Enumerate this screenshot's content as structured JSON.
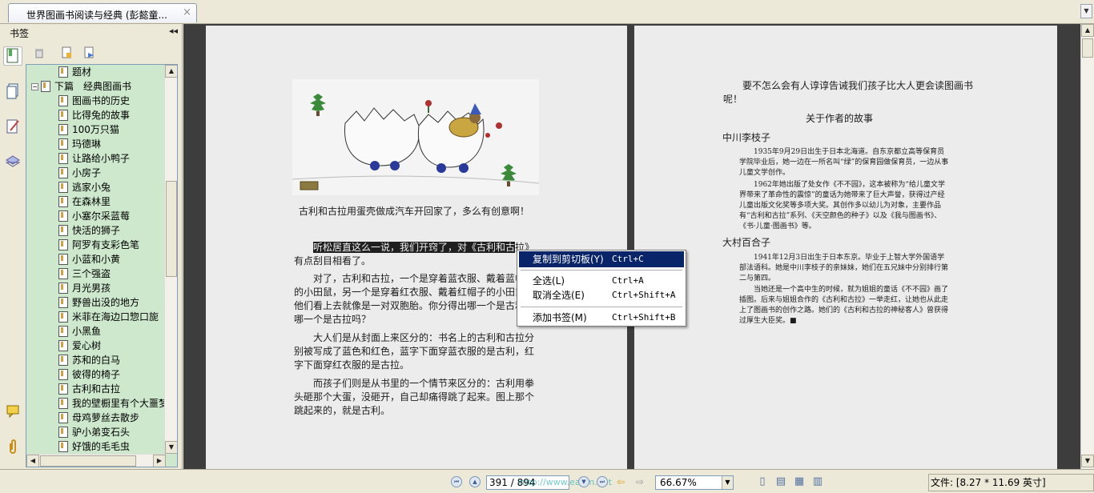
{
  "tab": {
    "title": "世界图画书阅读与经典 (彭懿童...",
    "close": "×",
    "menu": "▼"
  },
  "sidebar": {
    "title": "书签",
    "collapse": "◂◂",
    "bookmarks": [
      {
        "label": "题材",
        "level": 2
      },
      {
        "label": "下篇　经典图画书",
        "level": 1,
        "expanded": true,
        "toggle": "−"
      },
      {
        "label": "图画书的历史",
        "level": 2
      },
      {
        "label": "比得兔的故事",
        "level": 2
      },
      {
        "label": "100万只猫",
        "level": 2
      },
      {
        "label": "玛德琳",
        "level": 2
      },
      {
        "label": "让路给小鸭子",
        "level": 2
      },
      {
        "label": "小房子",
        "level": 2
      },
      {
        "label": "逃家小兔",
        "level": 2
      },
      {
        "label": "在森林里",
        "level": 2
      },
      {
        "label": "小塞尔采蓝莓",
        "level": 2
      },
      {
        "label": "快活的狮子",
        "level": 2
      },
      {
        "label": "阿罗有支彩色笔",
        "level": 2
      },
      {
        "label": "小蓝和小黄",
        "level": 2
      },
      {
        "label": "三个强盗",
        "level": 2
      },
      {
        "label": "月光男孩",
        "level": 2
      },
      {
        "label": "野兽出没的地方",
        "level": 2
      },
      {
        "label": "米菲在海边口惣口旎",
        "level": 2
      },
      {
        "label": "小黑鱼",
        "level": 2
      },
      {
        "label": "爱心树",
        "level": 2
      },
      {
        "label": "苏和的白马",
        "level": 2
      },
      {
        "label": "彼得的椅子",
        "level": 2
      },
      {
        "label": "古利和古拉",
        "level": 2
      },
      {
        "label": "我的壁橱里有个大噩梦",
        "level": 2
      },
      {
        "label": "母鸡萝丝去散步",
        "level": 2
      },
      {
        "label": "驴小弟变石头",
        "level": 2
      },
      {
        "label": "好饿的毛毛虫",
        "level": 2
      }
    ]
  },
  "left_page": {
    "caption": "古利和古拉用蛋壳做成汽车开回家了，多么有创意啊！",
    "p1_highlight": "听松居直这么一说，我们开窍了，对《古利和古",
    "p1_rest": "拉》有点刮目相看了。",
    "p2": "对了，古利和古拉，一个是穿着蓝衣服、戴着蓝帽子的小田鼠，另一个是穿着红衣服、戴着红帽子的小田鼠，他们看上去就像是一对双胞胎。你分得出哪一个是古利、哪一个是古拉吗？",
    "p3": "大人们是从封面上来区分的：书名上的古利和古拉分别被写成了蓝色和红色，蓝字下面穿蓝衣服的是古利，红字下面穿红衣服的是古拉。",
    "p4": "而孩子们则是从书里的一个情节来区分的：古利用拳头砸那个大蛋，没砸开，自己却痛得跳了起来。图上那个跳起来的，就是古利。"
  },
  "right_page": {
    "intro": "要不怎么会有人谆谆告诫我们孩子比大人更会读图画书呢！",
    "heading": "关于作者的故事",
    "author1": "中川李枝子",
    "a1p1": "1935年9月29日出生于日本北海道。自东京都立高等保育员学院毕业后，她一边在一所名叫“绿”的保育园做保育员，一边从事儿童文学创作。",
    "a1p2": "1962年她出版了处女作《不不园》，这本被称为“给儿童文学界带来了革命性的震惊”的童话为她带来了巨大声誉，获得过产经儿童出版文化奖等多项大奖。其创作多以幼儿为对象，主要作品有“古利和古拉”系列、《天空颜色的种子》以及《我与图画书》、《书·儿童·图画书》等。",
    "author2": "大村百合子",
    "a2p1": "1941年12月3日出生于日本东京。毕业于上智大学外国语学部法语科。她是中川李枝子的亲妹妹，她们在五兄妹中分别排行第二与第四。",
    "a2p2": "当她还是一个高中生的时候，就为姐姐的童话《不不园》画了插图。后来与姐姐合作的《古利和古拉》一举走红，让她也从此走上了图画书的创作之路。她们的《古利和古拉的神秘客人》曾获得过厚生大臣奖。■"
  },
  "context_menu": {
    "items": [
      {
        "label": "复制到剪切板(Y)",
        "shortcut": "Ctrl+C"
      },
      {
        "label": "全选(L)",
        "shortcut": "Ctrl+A"
      },
      {
        "label": "取消全选(E)",
        "shortcut": "Ctrl+Shift+A"
      },
      {
        "label": "添加书签(M)",
        "shortcut": "Ctrl+Shift+B"
      }
    ]
  },
  "status": {
    "page": "391 / 894",
    "watermark": "http://www.eanm.net",
    "zoom": "66.67%",
    "file_info": "文件: [8.27 * 11.69 英寸]"
  },
  "colors": {
    "sidebar_tree_bg": "#cde8cd",
    "menu_highlight": "#0a246a",
    "viewer_bg": "#3d3d3d"
  }
}
